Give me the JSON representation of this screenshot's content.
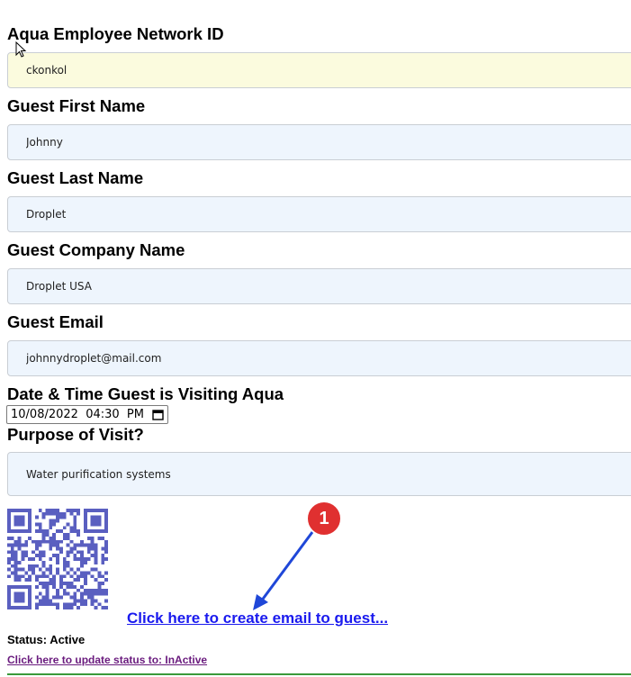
{
  "fields": {
    "network_id": {
      "label": "Aqua Employee Network ID",
      "value": "ckonkol"
    },
    "first_name": {
      "label": "Guest First Name",
      "value": "Johnny"
    },
    "last_name": {
      "label": "Guest Last Name",
      "value": "Droplet"
    },
    "company": {
      "label": "Guest Company Name",
      "value": "Droplet USA"
    },
    "email": {
      "label": "Guest Email",
      "value": "johnnydroplet@mail.com"
    },
    "visit_datetime": {
      "label": "Date & Time Guest is Visiting Aqua",
      "value": "10/08/2022  04:30  PM"
    },
    "purpose": {
      "label": "Purpose of Visit?",
      "value": "Water purification systems"
    }
  },
  "qr": {
    "icon": "qr-code-icon",
    "color": "#5a5fc0"
  },
  "links": {
    "create_email": "Click here to create email to guest...",
    "update_status": "Click here to update status to: InActive"
  },
  "status": {
    "text": "Status: Active"
  },
  "annotation": {
    "number": "1",
    "badge_color": "#e03030",
    "arrow_color": "#1f47d8"
  },
  "colors": {
    "link": "#1a1aee",
    "visited_link": "#6a1b7e",
    "field_bg": "#eef5fd",
    "field_bg_highlight": "#fbfbde",
    "bottom_rule": "#3a9a3a"
  }
}
